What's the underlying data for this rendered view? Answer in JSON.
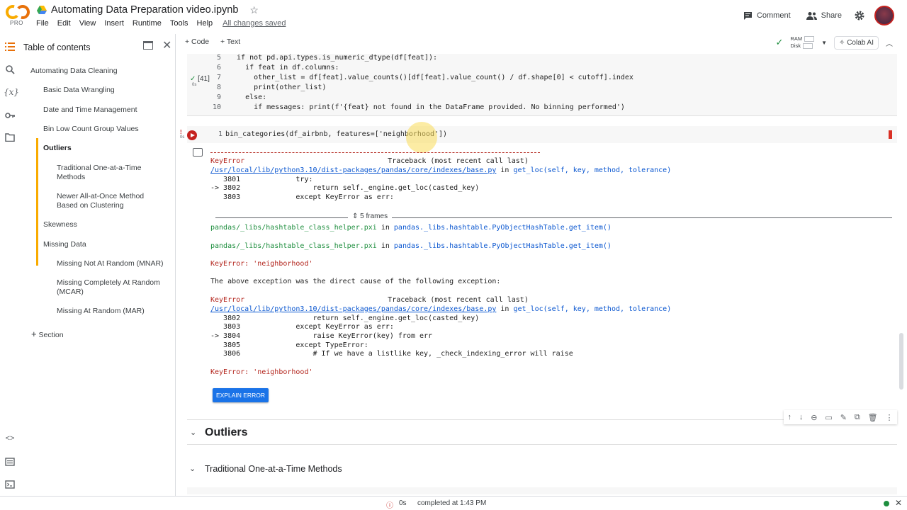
{
  "app": {
    "logo": "CO",
    "pro_label": "PRO",
    "title": "Automating Data Preparation video.ipynb",
    "saved_status": "All changes saved",
    "menu": [
      "File",
      "Edit",
      "View",
      "Insert",
      "Runtime",
      "Tools",
      "Help"
    ],
    "comment_label": "Comment",
    "share_label": "Share"
  },
  "toolbar": {
    "code_label": "+ Code",
    "text_label": "+ Text",
    "ram_label": "RAM",
    "disk_label": "Disk",
    "colab_ai_label": "Colab AI"
  },
  "toc": {
    "title": "Table of contents",
    "items": [
      {
        "label": "Automating Data Cleaning"
      },
      {
        "label": "Basic Data Wrangling"
      },
      {
        "label": "Date and Time Management"
      },
      {
        "label": "Bin Low Count Group Values"
      },
      {
        "label": "Outliers"
      },
      {
        "label": "Traditional One-at-a-Time Methods"
      },
      {
        "label": "Newer All-at-Once Method Based on Clustering"
      },
      {
        "label": "Skewness"
      },
      {
        "label": "Missing Data"
      },
      {
        "label": "Missing Not At Random (MNAR)"
      },
      {
        "label": "Missing Completely At Random (MCAR)"
      },
      {
        "label": "Missing At Random (MAR)"
      }
    ],
    "section_label": "Section"
  },
  "cell1": {
    "exec_count": "[41]",
    "exec_time": "0s",
    "lines": [
      {
        "num": "5",
        "code": "  if not pd.api.types.is_numeric_dtype(df[feat]):"
      },
      {
        "num": "6",
        "code": "    if feat in df.columns:"
      },
      {
        "num": "7",
        "code": "      other_list = df[feat].value_counts()[df[feat].value_count() / df.shape[0] < cutoff].index"
      },
      {
        "num": "8",
        "code": "      print(other_list)"
      },
      {
        "num": "9",
        "code": "    else:"
      },
      {
        "num": "10",
        "code": "      if messages: print(f'{feat} not found in the DataFrame provided. No binning performed')"
      }
    ]
  },
  "cell2": {
    "exec_time": "0s",
    "line_num": "1",
    "code": "bin_categories(df_airbnb, features=['neighborhood'])"
  },
  "output": {
    "dashes": "---------------------------------------------------------------------------",
    "block1": {
      "error_name": "KeyError",
      "traceback_header": "Traceback (most recent call last)",
      "file_path": "/usr/local/lib/python3.10/dist-packages/pandas/core/indexes/base.py",
      "in_word": " in ",
      "func": "get_loc(self, key, method, tolerance)",
      "lines": [
        "   3801             try:",
        "-> 3802                 return self._engine.get_loc(casted_key)",
        "   3803             except KeyError as err:"
      ]
    },
    "frames_label": "5 frames",
    "hashtable1": {
      "file": "pandas/_libs/hashtable_class_helper.pxi",
      "func": "pandas._libs.hashtable.PyObjectHashTable.get_item()"
    },
    "hashtable2": {
      "file": "pandas/_libs/hashtable_class_helper.pxi",
      "func": "pandas._libs.hashtable.PyObjectHashTable.get_item()"
    },
    "keyerror1": "KeyError: 'neighborhood'",
    "cause_text": "The above exception was the direct cause of the following exception:",
    "block2": {
      "error_name": "KeyError",
      "traceback_header": "Traceback (most recent call last)",
      "file_path": "/usr/local/lib/python3.10/dist-packages/pandas/core/indexes/base.py",
      "in_word": " in ",
      "func": "get_loc(self, key, method, tolerance)",
      "lines": [
        "   3802                 return self._engine.get_loc(casted_key)",
        "   3803             except KeyError as err:",
        "-> 3804                 raise KeyError(key) from err",
        "   3805             except TypeError:",
        "   3806                 # If we have a listlike key, _check_indexing_error will raise"
      ]
    },
    "keyerror2": "KeyError: 'neighborhood'",
    "explain_label": "EXPLAIN ERROR"
  },
  "sections": {
    "outliers": "Outliers",
    "traditional": "Traditional One-at-a-Time Methods"
  },
  "status": {
    "exec_time": "0s",
    "completed": "completed at 1:43 PM"
  }
}
